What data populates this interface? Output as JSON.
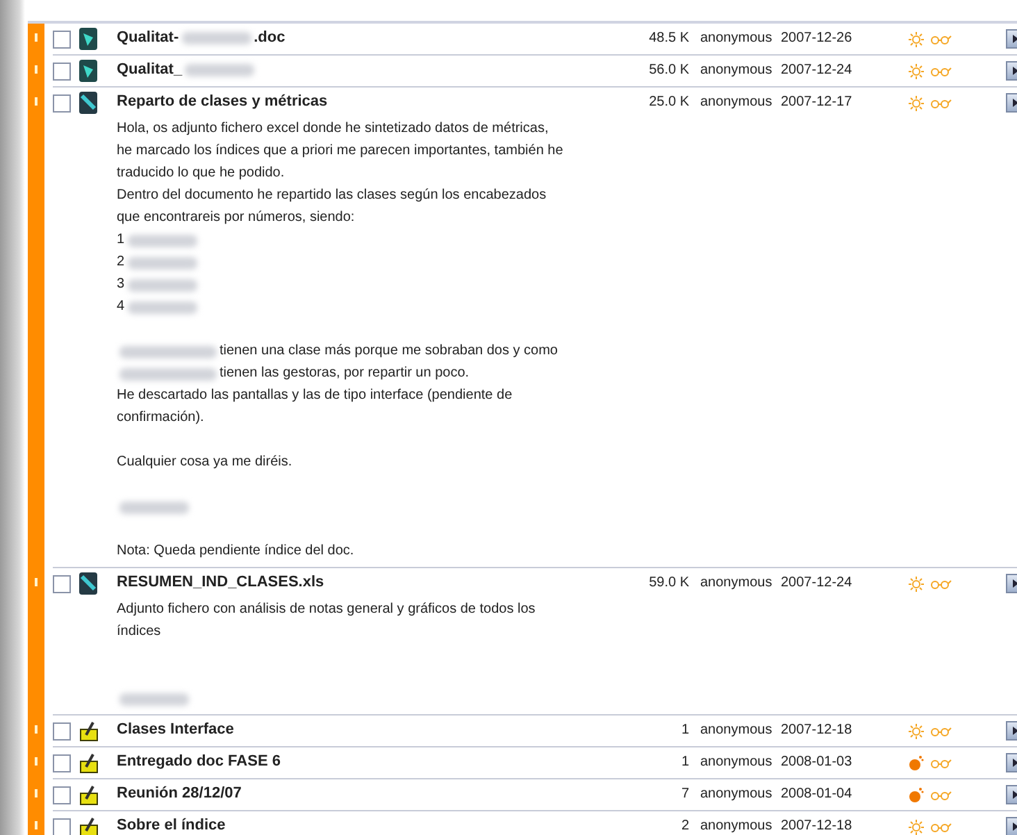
{
  "rows": [
    {
      "kind": "word",
      "checked": false,
      "alert": false,
      "title": [
        {
          "text": "Qualitat-"
        },
        {
          "kind": "redacted"
        },
        {
          "text": ".doc"
        }
      ],
      "size": "48.5 K",
      "author": "anonymous",
      "date": "2007-12-26"
    },
    {
      "kind": "word",
      "checked": false,
      "alert": false,
      "title": [
        {
          "text": "Qualitat_"
        },
        {
          "kind": "redacted"
        }
      ],
      "size": "56.0 K",
      "author": "anonymous",
      "date": "2007-12-24"
    },
    {
      "kind": "excel",
      "checked": false,
      "alert": false,
      "title": [
        {
          "text": "Reparto de clases y métricas"
        }
      ],
      "size": "25.0 K",
      "author": "anonymous",
      "date": "2007-12-17",
      "body": [
        {
          "parts": [
            {
              "text": "Hola, os adjunto fichero excel donde he sintetizado datos de métricas,"
            }
          ]
        },
        {
          "parts": [
            {
              "text": "he marcado los índices que a priori me parecen importantes, también he"
            }
          ]
        },
        {
          "parts": [
            {
              "text": "traducido lo que he podido."
            }
          ]
        },
        {
          "parts": [
            {
              "text": "Dentro del documento he repartido las clases según los encabezados"
            }
          ]
        },
        {
          "parts": [
            {
              "text": "que encontrareis por números, siendo:"
            }
          ]
        },
        {
          "parts": [
            {
              "text": "1"
            },
            {
              "kind": "redacted"
            }
          ]
        },
        {
          "parts": [
            {
              "text": "2"
            },
            {
              "kind": "redacted"
            }
          ]
        },
        {
          "parts": [
            {
              "text": "3"
            },
            {
              "kind": "redacted"
            }
          ]
        },
        {
          "parts": [
            {
              "text": "4"
            },
            {
              "kind": "redacted"
            }
          ]
        },
        {
          "kind": "blank"
        },
        {
          "parts": [
            {
              "kind": "redacted"
            },
            {
              "text": "tienen una clase más porque me sobraban dos y como"
            }
          ]
        },
        {
          "parts": [
            {
              "kind": "redacted"
            },
            {
              "text": "tienen las gestoras, por repartir un poco."
            }
          ]
        },
        {
          "parts": [
            {
              "text": "He descartado las pantallas y las de tipo interface (pendiente de"
            }
          ]
        },
        {
          "parts": [
            {
              "text": "confirmación)."
            }
          ]
        },
        {
          "kind": "blank"
        },
        {
          "parts": [
            {
              "text": "Cualquier cosa ya me diréis."
            }
          ]
        },
        {
          "kind": "blank"
        },
        {
          "parts": [
            {
              "kind": "redacted"
            }
          ]
        },
        {
          "kind": "blank"
        },
        {
          "parts": [
            {
              "text": "Nota: Queda pendiente índice del doc."
            }
          ]
        }
      ]
    },
    {
      "kind": "excel",
      "checked": false,
      "alert": false,
      "title": [
        {
          "text": "RESUMEN_IND_CLASES.xls"
        }
      ],
      "size": "59.0 K",
      "author": "anonymous",
      "date": "2007-12-24",
      "body": [
        {
          "parts": [
            {
              "text": "Adjunto fichero con análisis de notas general y gráficos de todos los"
            }
          ]
        },
        {
          "parts": [
            {
              "text": "índices"
            }
          ]
        },
        {
          "kind": "blank"
        },
        {
          "kind": "blank"
        },
        {
          "parts": [
            {
              "kind": "redacted"
            }
          ]
        }
      ]
    },
    {
      "kind": "topic",
      "checked": false,
      "alert": false,
      "title": [
        {
          "text": "Clases Interface"
        }
      ],
      "size": "1",
      "author": "anonymous",
      "date": "2007-12-18"
    },
    {
      "kind": "topic",
      "checked": false,
      "alert": true,
      "title": [
        {
          "text": "Entregado doc FASE 6"
        }
      ],
      "size": "1",
      "author": "anonymous",
      "date": "2008-01-03"
    },
    {
      "kind": "topic",
      "checked": false,
      "alert": true,
      "title": [
        {
          "text": "Reunión 28/12/07"
        }
      ],
      "size": "7",
      "author": "anonymous",
      "date": "2008-01-04"
    },
    {
      "kind": "topic",
      "checked": false,
      "alert": false,
      "title": [
        {
          "text": "Sobre el índice"
        }
      ],
      "size": "2",
      "author": "anonymous",
      "date": "2007-12-18"
    }
  ]
}
